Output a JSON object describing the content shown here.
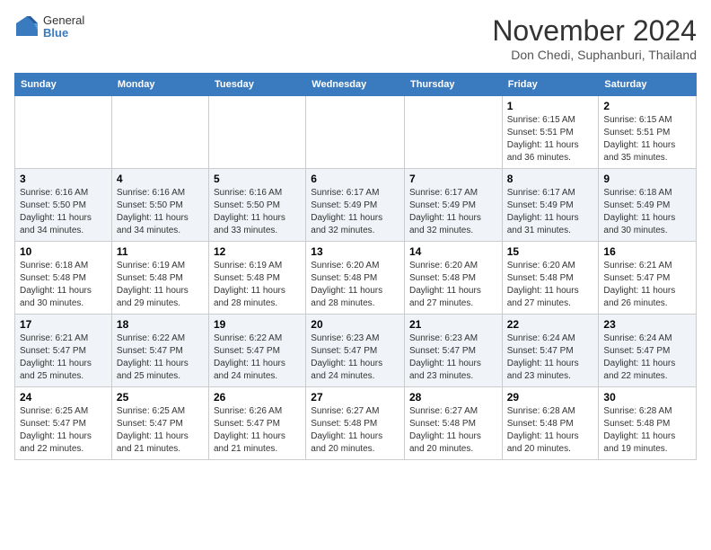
{
  "logo": {
    "general": "General",
    "blue": "Blue"
  },
  "header": {
    "month": "November 2024",
    "location": "Don Chedi, Suphanburi, Thailand"
  },
  "weekdays": [
    "Sunday",
    "Monday",
    "Tuesday",
    "Wednesday",
    "Thursday",
    "Friday",
    "Saturday"
  ],
  "weeks": [
    [
      {
        "day": "",
        "info": ""
      },
      {
        "day": "",
        "info": ""
      },
      {
        "day": "",
        "info": ""
      },
      {
        "day": "",
        "info": ""
      },
      {
        "day": "",
        "info": ""
      },
      {
        "day": "1",
        "info": "Sunrise: 6:15 AM\nSunset: 5:51 PM\nDaylight: 11 hours and 36 minutes."
      },
      {
        "day": "2",
        "info": "Sunrise: 6:15 AM\nSunset: 5:51 PM\nDaylight: 11 hours and 35 minutes."
      }
    ],
    [
      {
        "day": "3",
        "info": "Sunrise: 6:16 AM\nSunset: 5:50 PM\nDaylight: 11 hours and 34 minutes."
      },
      {
        "day": "4",
        "info": "Sunrise: 6:16 AM\nSunset: 5:50 PM\nDaylight: 11 hours and 34 minutes."
      },
      {
        "day": "5",
        "info": "Sunrise: 6:16 AM\nSunset: 5:50 PM\nDaylight: 11 hours and 33 minutes."
      },
      {
        "day": "6",
        "info": "Sunrise: 6:17 AM\nSunset: 5:49 PM\nDaylight: 11 hours and 32 minutes."
      },
      {
        "day": "7",
        "info": "Sunrise: 6:17 AM\nSunset: 5:49 PM\nDaylight: 11 hours and 32 minutes."
      },
      {
        "day": "8",
        "info": "Sunrise: 6:17 AM\nSunset: 5:49 PM\nDaylight: 11 hours and 31 minutes."
      },
      {
        "day": "9",
        "info": "Sunrise: 6:18 AM\nSunset: 5:49 PM\nDaylight: 11 hours and 30 minutes."
      }
    ],
    [
      {
        "day": "10",
        "info": "Sunrise: 6:18 AM\nSunset: 5:48 PM\nDaylight: 11 hours and 30 minutes."
      },
      {
        "day": "11",
        "info": "Sunrise: 6:19 AM\nSunset: 5:48 PM\nDaylight: 11 hours and 29 minutes."
      },
      {
        "day": "12",
        "info": "Sunrise: 6:19 AM\nSunset: 5:48 PM\nDaylight: 11 hours and 28 minutes."
      },
      {
        "day": "13",
        "info": "Sunrise: 6:20 AM\nSunset: 5:48 PM\nDaylight: 11 hours and 28 minutes."
      },
      {
        "day": "14",
        "info": "Sunrise: 6:20 AM\nSunset: 5:48 PM\nDaylight: 11 hours and 27 minutes."
      },
      {
        "day": "15",
        "info": "Sunrise: 6:20 AM\nSunset: 5:48 PM\nDaylight: 11 hours and 27 minutes."
      },
      {
        "day": "16",
        "info": "Sunrise: 6:21 AM\nSunset: 5:47 PM\nDaylight: 11 hours and 26 minutes."
      }
    ],
    [
      {
        "day": "17",
        "info": "Sunrise: 6:21 AM\nSunset: 5:47 PM\nDaylight: 11 hours and 25 minutes."
      },
      {
        "day": "18",
        "info": "Sunrise: 6:22 AM\nSunset: 5:47 PM\nDaylight: 11 hours and 25 minutes."
      },
      {
        "day": "19",
        "info": "Sunrise: 6:22 AM\nSunset: 5:47 PM\nDaylight: 11 hours and 24 minutes."
      },
      {
        "day": "20",
        "info": "Sunrise: 6:23 AM\nSunset: 5:47 PM\nDaylight: 11 hours and 24 minutes."
      },
      {
        "day": "21",
        "info": "Sunrise: 6:23 AM\nSunset: 5:47 PM\nDaylight: 11 hours and 23 minutes."
      },
      {
        "day": "22",
        "info": "Sunrise: 6:24 AM\nSunset: 5:47 PM\nDaylight: 11 hours and 23 minutes."
      },
      {
        "day": "23",
        "info": "Sunrise: 6:24 AM\nSunset: 5:47 PM\nDaylight: 11 hours and 22 minutes."
      }
    ],
    [
      {
        "day": "24",
        "info": "Sunrise: 6:25 AM\nSunset: 5:47 PM\nDaylight: 11 hours and 22 minutes."
      },
      {
        "day": "25",
        "info": "Sunrise: 6:25 AM\nSunset: 5:47 PM\nDaylight: 11 hours and 21 minutes."
      },
      {
        "day": "26",
        "info": "Sunrise: 6:26 AM\nSunset: 5:47 PM\nDaylight: 11 hours and 21 minutes."
      },
      {
        "day": "27",
        "info": "Sunrise: 6:27 AM\nSunset: 5:48 PM\nDaylight: 11 hours and 20 minutes."
      },
      {
        "day": "28",
        "info": "Sunrise: 6:27 AM\nSunset: 5:48 PM\nDaylight: 11 hours and 20 minutes."
      },
      {
        "day": "29",
        "info": "Sunrise: 6:28 AM\nSunset: 5:48 PM\nDaylight: 11 hours and 20 minutes."
      },
      {
        "day": "30",
        "info": "Sunrise: 6:28 AM\nSunset: 5:48 PM\nDaylight: 11 hours and 19 minutes."
      }
    ]
  ]
}
